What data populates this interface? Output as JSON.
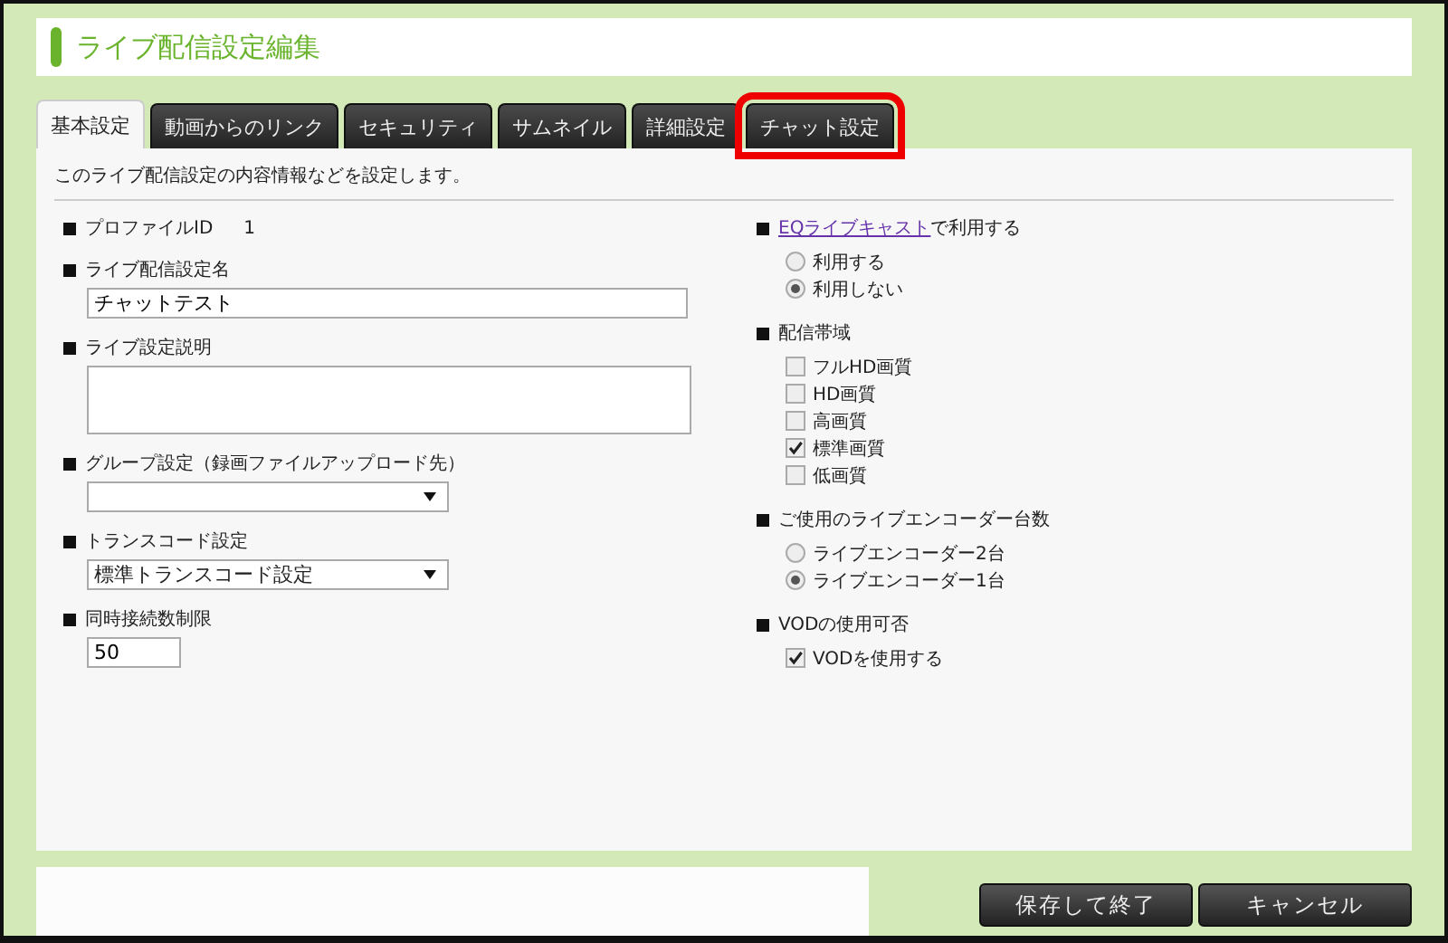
{
  "page_title": "ライブ配信設定編集",
  "tabs": [
    {
      "label": "基本設定",
      "selected": true,
      "highlighted": false
    },
    {
      "label": "動画からのリンク",
      "selected": false,
      "highlighted": false
    },
    {
      "label": "セキュリティ",
      "selected": false,
      "highlighted": false
    },
    {
      "label": "サムネイル",
      "selected": false,
      "highlighted": false
    },
    {
      "label": "詳細設定",
      "selected": false,
      "highlighted": false
    },
    {
      "label": "チャット設定",
      "selected": false,
      "highlighted": true
    }
  ],
  "description": "このライブ配信設定の内容情報などを設定します。",
  "left_fields": [
    {
      "kind": "static",
      "label": "プロファイルID",
      "value": "1"
    },
    {
      "kind": "text",
      "label": "ライブ配信設定名",
      "value": "チャットテスト"
    },
    {
      "kind": "textarea",
      "label": "ライブ設定説明"
    },
    {
      "kind": "select",
      "label": "グループ設定（録画ファイルアップロード先）"
    },
    {
      "kind": "select",
      "label": "トランスコード設定",
      "value": "標準トランスコード設定"
    },
    {
      "kind": "number",
      "label": "同時接続数制限",
      "value": "50"
    }
  ],
  "right_fields": [
    {
      "kind": "radio",
      "link": "EQライブキャスト",
      "label": "で利用する",
      "options": [
        {
          "label": "利用する",
          "selected": false
        },
        {
          "label": "利用しない",
          "selected": true
        }
      ]
    },
    {
      "kind": "checkbox",
      "label": "配信帯域",
      "options": [
        {
          "label": "フルHD画質",
          "checked": false
        },
        {
          "label": "HD画質",
          "checked": false
        },
        {
          "label": "高画質",
          "checked": false
        },
        {
          "label": "標準画質",
          "checked": true
        },
        {
          "label": "低画質",
          "checked": false
        }
      ]
    },
    {
      "kind": "radio",
      "label": "ご使用のライブエンコーダー台数",
      "options": [
        {
          "label": "ライブエンコーダー2台",
          "selected": false
        },
        {
          "label": "ライブエンコーダー1台",
          "selected": true
        }
      ]
    },
    {
      "kind": "checkbox",
      "label": "VODの使用可否",
      "options": [
        {
          "label": "VODを使用する",
          "checked": true
        }
      ]
    }
  ],
  "buttons": [
    "保存して終了",
    "キャンセル"
  ]
}
